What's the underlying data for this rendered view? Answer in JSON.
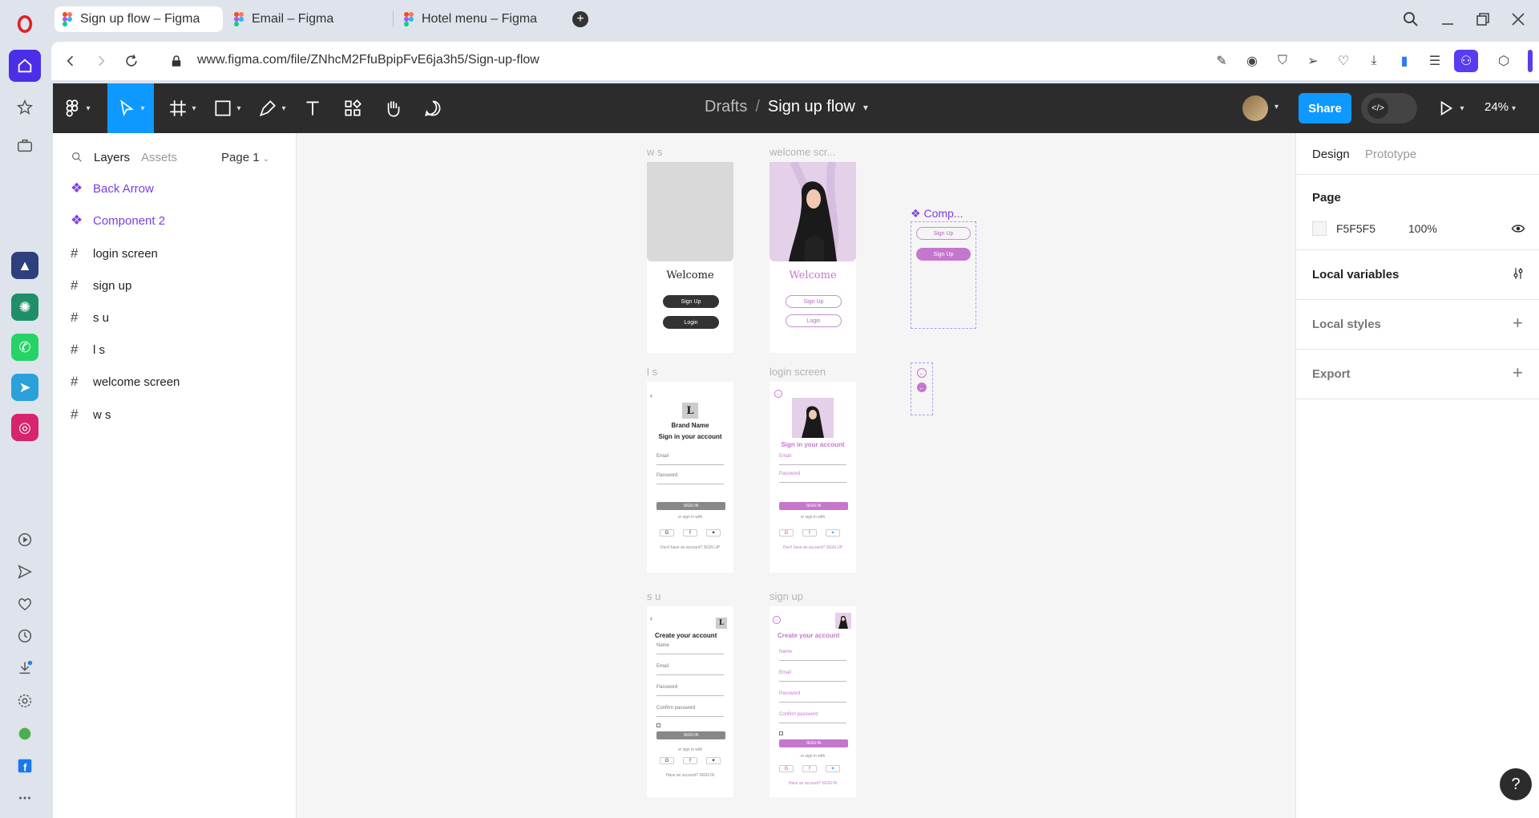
{
  "browser": {
    "tabs": [
      {
        "label": "Sign up flow – Figma",
        "active": true
      },
      {
        "label": "Email – Figma",
        "active": false
      },
      {
        "label": "Hotel menu – Figma",
        "active": false
      }
    ],
    "url": "www.figma.com/file/ZNhcM2FfuBpipFvE6ja3h5/Sign-up-flow"
  },
  "toolbar": {
    "breadcrumb_root": "Drafts",
    "breadcrumb_sep": "/",
    "file_name": "Sign up flow",
    "share_label": "Share",
    "zoom": "24%"
  },
  "left_panel": {
    "tab_layers": "Layers",
    "tab_assets": "Assets",
    "page_selector": "Page 1",
    "layers": [
      {
        "label": "Back Arrow",
        "type": "component"
      },
      {
        "label": "Component 2",
        "type": "component"
      },
      {
        "label": "login screen",
        "type": "frame"
      },
      {
        "label": "sign up",
        "type": "frame"
      },
      {
        "label": "s u",
        "type": "frame"
      },
      {
        "label": "l s",
        "type": "frame"
      },
      {
        "label": "welcome screen",
        "type": "frame"
      },
      {
        "label": "w s",
        "type": "frame"
      }
    ]
  },
  "right_panel": {
    "tab_design": "Design",
    "tab_prototype": "Prototype",
    "page_section": "Page",
    "page_color": "F5F5F5",
    "page_opacity": "100%",
    "local_variables": "Local variables",
    "local_styles": "Local styles",
    "export": "Export"
  },
  "canvas": {
    "frames": {
      "ws_label": "w s",
      "welcome_label": "welcome scr...",
      "ls_label": "l s",
      "login_label": "login screen",
      "su_label": "s u",
      "signup_label": "sign up",
      "comp_label": "Comp...",
      "welcome_title": "Welcome",
      "sign_up_btn": "Sign Up",
      "login_btn": "Login",
      "brand_logo": "L",
      "brand_name": "Brand Name",
      "sign_in_title": "Sign in your account",
      "email": "Email",
      "password": "Password",
      "sign_in_btn": "SIGN IN",
      "or_sign_in_with": "or sign in with",
      "no_account": "Don't have an account? SIGN UP",
      "create_title": "Create your account",
      "name": "Name",
      "confirm_password": "Confirm password",
      "have_account": "Have an account? SIGN IN"
    }
  },
  "colors": {
    "accent": "#7b3fe4",
    "share": "#0d99ff",
    "pink": "#c477cc"
  }
}
